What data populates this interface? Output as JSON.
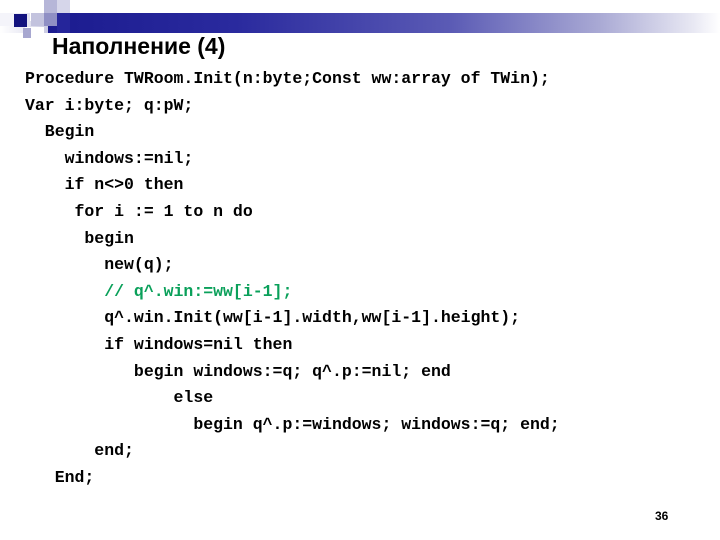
{
  "slide": {
    "title": "Наполнение (4)",
    "page_number": "36",
    "accent_color": "#1b1b8f",
    "comment_color": "#0aa05a"
  },
  "header": {
    "decoration_name": "blue-squares-banner"
  },
  "code": {
    "language": "pascal",
    "lines": [
      {
        "text": "Procedure TWRoom.Init(n:byte;Const ww:array of TWin);",
        "type": "code"
      },
      {
        "text": "Var i:byte; q:pW;",
        "type": "code"
      },
      {
        "text": "  Begin",
        "type": "code"
      },
      {
        "text": "    windows:=nil;",
        "type": "code"
      },
      {
        "text": "    if n<>0 then",
        "type": "code"
      },
      {
        "text": "     for i := 1 to n do",
        "type": "code"
      },
      {
        "text": "      begin",
        "type": "code"
      },
      {
        "text": "        new(q);",
        "type": "code"
      },
      {
        "text": "        // q^.win:=ww[i-1];",
        "type": "comment"
      },
      {
        "text": "        q^.win.Init(ww[i-1].width,ww[i-1].height);",
        "type": "code"
      },
      {
        "text": "        if windows=nil then",
        "type": "code"
      },
      {
        "text": "           begin windows:=q; q^.p:=nil; end",
        "type": "code"
      },
      {
        "text": "               else",
        "type": "code"
      },
      {
        "text": "                 begin q^.p:=windows; windows:=q; end;",
        "type": "code"
      },
      {
        "text": "       end;",
        "type": "code"
      },
      {
        "text": "   End;",
        "type": "code"
      }
    ]
  }
}
